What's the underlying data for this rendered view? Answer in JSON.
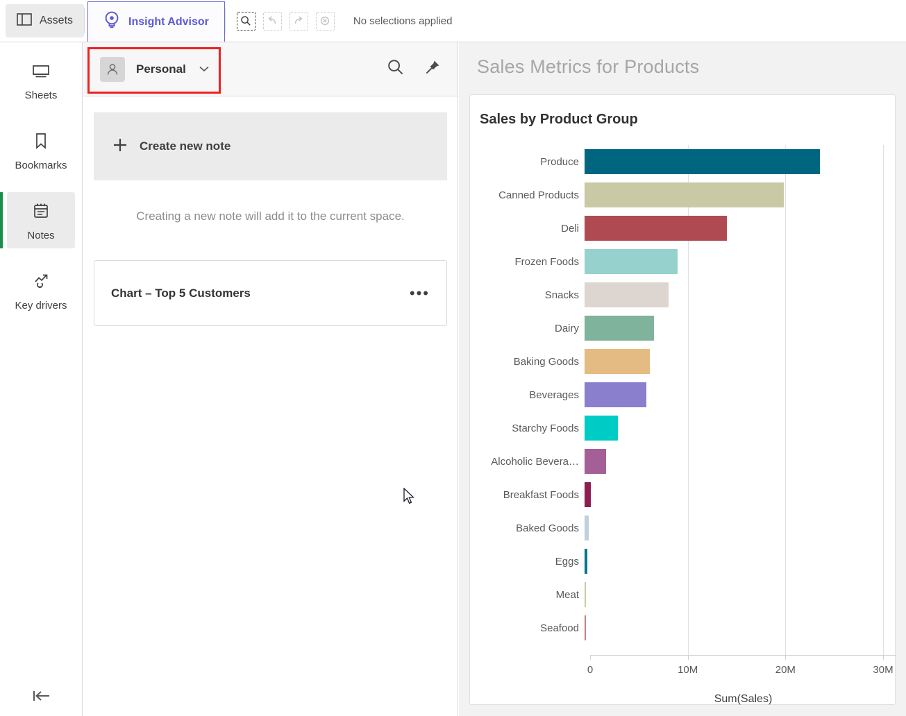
{
  "topbar": {
    "assets_label": "Assets",
    "assets_icon": "panel-layout-icon",
    "insight_advisor_label": "Insight Advisor",
    "insight_advisor_icon": "lightbulb-eye-icon",
    "selection_tools": [
      {
        "name": "selection-search-icon",
        "label": "Selection search",
        "disabled": false
      },
      {
        "name": "undo-icon",
        "label": "Step back",
        "disabled": true
      },
      {
        "name": "redo-icon",
        "label": "Step forward",
        "disabled": true
      },
      {
        "name": "clear-selections-icon",
        "label": "Clear all selections",
        "disabled": true
      }
    ],
    "selection_status": "No selections applied",
    "accent_color": "#5b5bd6"
  },
  "rail": {
    "items": [
      {
        "label": "Sheets",
        "icon": "sheets-icon",
        "active": false
      },
      {
        "label": "Bookmarks",
        "icon": "bookmark-icon",
        "active": false
      },
      {
        "label": "Notes",
        "icon": "notes-icon",
        "active": true
      },
      {
        "label": "Key drivers",
        "icon": "key-drivers-icon",
        "active": false
      }
    ],
    "collapse_icon": "collapse-left-icon",
    "active_accent": "#1a8f4a"
  },
  "notes_panel": {
    "space_name": "Personal",
    "space_icon": "person-icon",
    "dropdown_icon": "chevron-down-icon",
    "search_icon": "search-icon",
    "pin_icon": "pin-icon",
    "create_note_label": "Create new note",
    "create_note_icon": "plus-icon",
    "hint": "Creating a new note will add it to the current space.",
    "note": {
      "title": "Chart – Top 5 Customers",
      "menu": "•••"
    },
    "highlight_color": "#ef2020"
  },
  "right_panel": {
    "title": "Sales Metrics for Products",
    "card_title": "Sales by Product Group"
  },
  "chart_data": {
    "type": "bar",
    "orientation": "horizontal",
    "title": "Sales by Product Group",
    "xlabel": "Sum(Sales)",
    "ylabel": "",
    "xlim": [
      0,
      30000000
    ],
    "xticks": [
      0,
      10000000,
      20000000,
      30000000
    ],
    "xticklabels": [
      "0",
      "10M",
      "20M",
      "30M"
    ],
    "grid": true,
    "legend": false,
    "categories": [
      "Produce",
      "Canned Products",
      "Deli",
      "Frozen Foods",
      "Snacks",
      "Dairy",
      "Baking Goods",
      "Beverages",
      "Starchy Foods",
      "Alcoholic Bevera…",
      "Breakfast Foods",
      "Baked Goods",
      "Eggs",
      "Meat",
      "Seafood"
    ],
    "values": [
      24100000,
      20400000,
      14600000,
      9500000,
      8600000,
      7100000,
      6700000,
      6300000,
      3400000,
      2200000,
      650000,
      450000,
      300000,
      60000,
      60000
    ],
    "colors": [
      "#006680",
      "#cac9a5",
      "#b04a52",
      "#96d1cd",
      "#ddd5d0",
      "#7fb39b",
      "#e4bb82",
      "#8a7fcc",
      "#00ccc6",
      "#a45f97",
      "#8c1f52",
      "#c3ced8",
      "#00758a",
      "#cbc9a2",
      "#c97f82"
    ]
  }
}
